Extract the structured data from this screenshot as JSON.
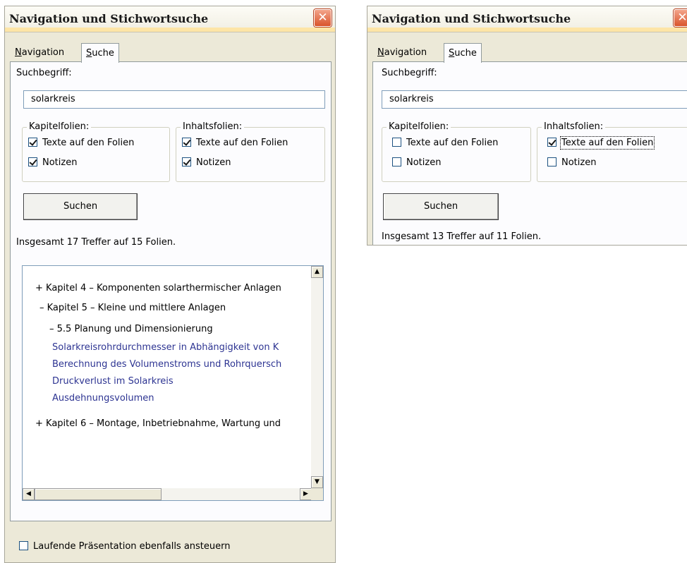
{
  "panel_left": {
    "title": "Navigation und Stichwortsuche",
    "tab_navigation_prefix": "N",
    "tab_navigation_rest": "avigation",
    "tab_search_prefix": "S",
    "tab_search_rest": "uche",
    "search_label": "Suchbegriff:",
    "search_value": "solarkreis",
    "group_chapters": "Kapitelfolien:",
    "group_content": "Inhaltsfolien:",
    "chk_chapter_text": "Texte auf den Folien",
    "chk_chapter_notes": "Notizen",
    "chk_content_text": "Texte auf den Folien",
    "chk_content_notes": "Notizen",
    "search_button": "Suchen",
    "result_text": "Insgesamt 17 Treffer auf 15 Folien.",
    "results": [
      "+ Kapitel 4 – Komponenten  solarthermischer Anlagen",
      "– Kapitel 5 – Kleine und mittlere Anlagen",
      "– 5.5 Planung und Dimensionierung",
      "Solarkreisrohrdurchmesser in Abhängigkeit von K",
      "Berechnung des Volumenstroms und Rohrquersch",
      "Druckverlust im Solarkreis",
      "Ausdehnungsvolumen",
      "+ Kapitel 6 – Montage, Inbetriebnahme,  Wartung und"
    ],
    "footer_checkbox": "Laufende Präsentation ebenfalls ansteuern",
    "checks": {
      "chapter_text": true,
      "chapter_notes": true,
      "content_text": true,
      "content_notes": true,
      "footer": false
    }
  },
  "panel_right": {
    "title": "Navigation und Stichwortsuche",
    "tab_navigation_prefix": "N",
    "tab_navigation_rest": "avigation",
    "tab_search_prefix": "S",
    "tab_search_rest": "uche",
    "search_label": "Suchbegriff:",
    "search_value": "solarkreis",
    "group_chapters": "Kapitelfolien:",
    "group_content": "Inhaltsfolien:",
    "chk_chapter_text": "Texte auf den Folien",
    "chk_chapter_notes": "Notizen",
    "chk_content_text": "Texte auf den Folien",
    "chk_content_notes": "Notizen",
    "search_button": "Suchen",
    "result_text": "Insgesamt 13 Treffer auf 11 Folien.",
    "checks": {
      "chapter_text": false,
      "chapter_notes": false,
      "content_text": true,
      "content_notes": false
    }
  },
  "icons": {
    "close": "close-icon",
    "scroll_up": "scroll-up-arrow-icon",
    "scroll_down": "scroll-down-arrow-icon",
    "scroll_left": "scroll-left-arrow-icon",
    "scroll_right": "scroll-right-arrow-icon"
  },
  "colors": {
    "dialog_bg": "#ece9d8",
    "title_stripe": "#fde5a6",
    "close_button": "#d9542c",
    "match_text": "#2d3492"
  }
}
